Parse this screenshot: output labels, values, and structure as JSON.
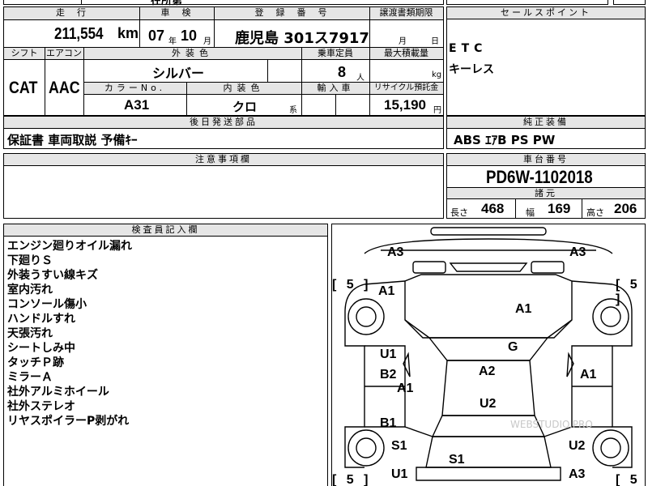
{
  "top_strip": {
    "partial_text": "在所第"
  },
  "vehicle_info": {
    "mileage_label": "走　行",
    "mileage_value": "211,554",
    "mileage_unit": "km",
    "inspection_label": "車　検",
    "inspection_year": "07",
    "inspection_year_unit": "年",
    "inspection_month": "10",
    "inspection_month_unit": "月",
    "registration_label": "登　録　番　号",
    "registration_value": "鹿児島 301ス7917",
    "transfer_label": "譲渡書類期限",
    "transfer_month_unit": "月",
    "transfer_day_unit": "日",
    "shift_label": "シフト",
    "shift_value": "CAT",
    "ac_label": "エアコン",
    "ac_value": "AAC",
    "exterior_color_label": "外装色",
    "exterior_color_value": "シルバー",
    "capacity_label": "乗車定員",
    "capacity_value": "8",
    "capacity_unit": "人",
    "max_load_label": "最大積載量",
    "max_load_unit": "kg",
    "color_no_label": "カラーNo.",
    "color_no_value": "A31",
    "interior_color_label": "内装色",
    "interior_color_value": "クロ",
    "interior_color_suffix": "系",
    "import_label": "輸入車",
    "recycle_label": "リサイクル預託金",
    "recycle_value": "15,190",
    "recycle_unit": "円"
  },
  "sales_points": {
    "header": "セールスポイント",
    "items": [
      "ETC",
      "キーレス"
    ]
  },
  "rear_parts": {
    "header": "後日発送部品",
    "value": "保証書 車両取説 予備ｷｰ"
  },
  "equipment": {
    "header": "純正装備",
    "value": "ABS ｴｱB PS PW"
  },
  "caution": {
    "header": "注意事項欄"
  },
  "chassis": {
    "header": "車台番号",
    "value": "PD6W-1102018"
  },
  "dimensions": {
    "header": "諸元",
    "length_label": "長さ",
    "length_value": "468",
    "width_label": "幅",
    "width_value": "169",
    "height_label": "高さ",
    "height_value": "206"
  },
  "inspector": {
    "header": "検査員記入欄",
    "notes": [
      "エンジン廻りオイル漏れ",
      "下廻りＳ",
      "外装うすい線キズ",
      "室内汚れ",
      "コンソール傷小",
      "ハンドルすれ",
      "天張汚れ",
      "シートしみ中",
      "タッチＰ跡",
      "ミラーＡ",
      "社外アルミホイール",
      "社外ステレオ",
      "リヤスポイラーP剥がれ"
    ]
  },
  "diagram": {
    "codes": {
      "front_left_top": "A3",
      "front_right_top": "A3",
      "left_upper": "A1",
      "hood": "A1",
      "door_front_left": "U1",
      "door_mid_left": "B2",
      "door_rear_left": "B1",
      "left_side_a1": "A1",
      "roof_g": "G",
      "roof_a2": "A2",
      "roof_u2": "U2",
      "right_door": "A1",
      "rear_left_s1": "S1",
      "rear_s1": "S1",
      "rear_right_u2": "U2",
      "bottom_left_u1": "U1",
      "bottom_right_a3": "A3"
    },
    "tire_left_top": "5",
    "tire_right_top": "5",
    "tire_left_bottom": "5",
    "tire_right_bottom": "5",
    "watermark": "WEBSTUDIO.PRO"
  }
}
